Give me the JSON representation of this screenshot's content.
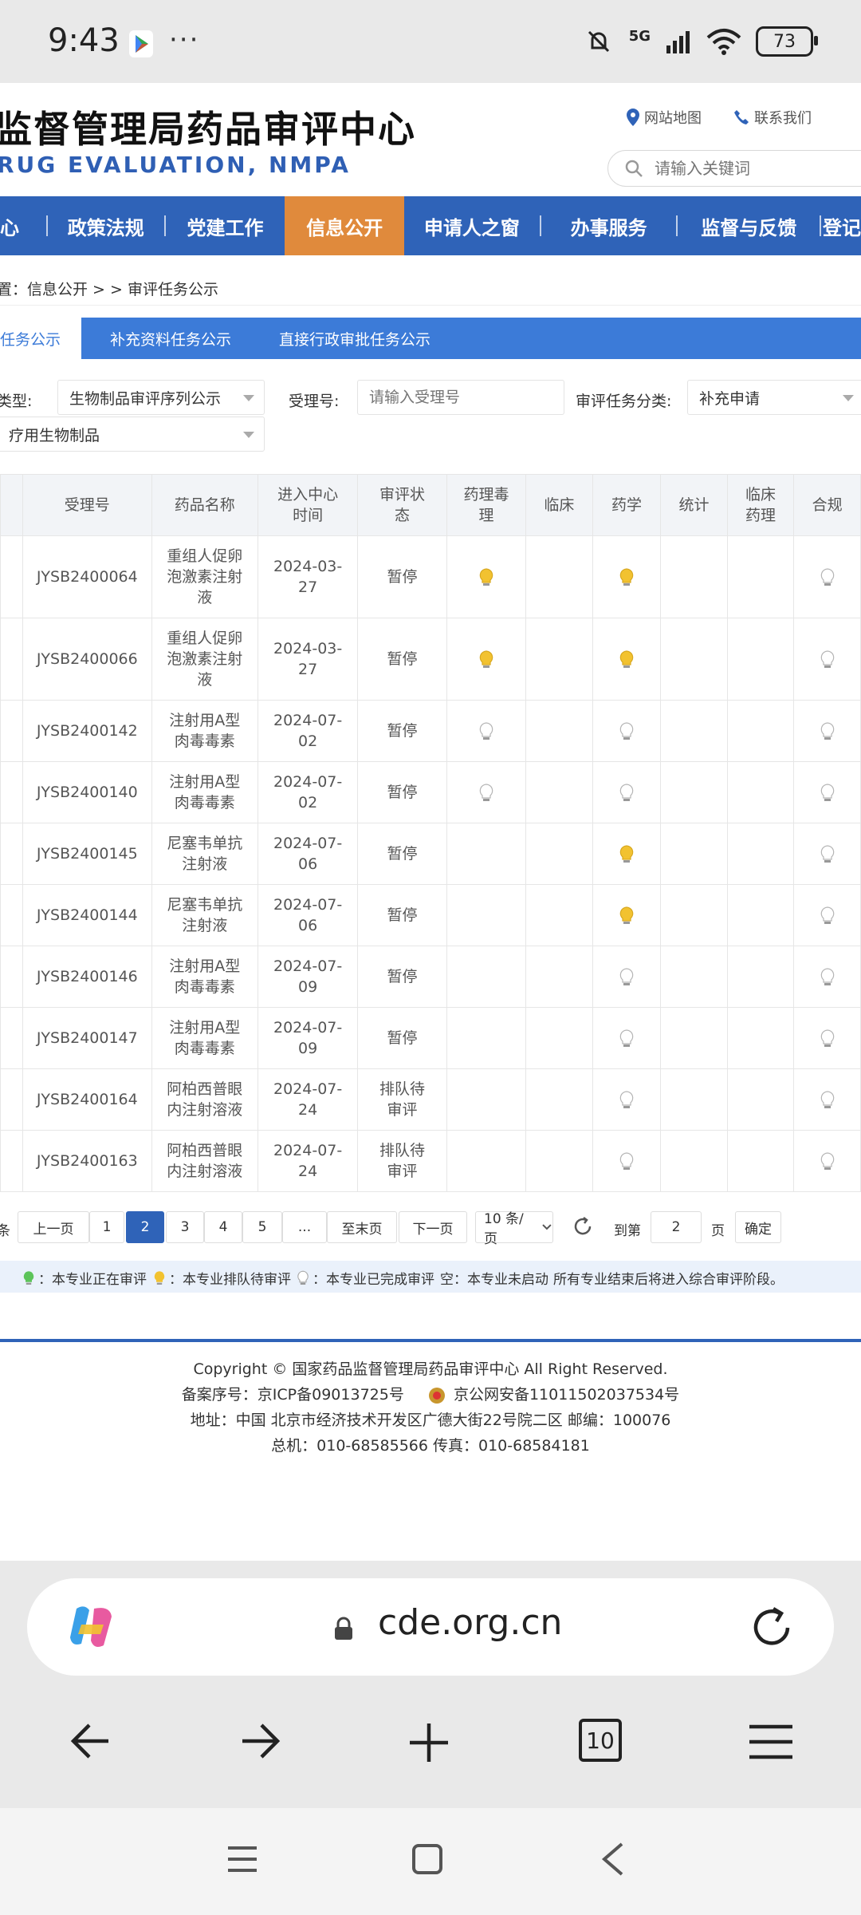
{
  "status_bar": {
    "time": "9:43",
    "dots": "···",
    "network": "5G",
    "battery": "73"
  },
  "header": {
    "title": "监督管理局药品审评中心",
    "subtitle": "RUG EVALUATION, NMPA",
    "links": [
      "网站地图",
      "联系我们"
    ],
    "search_placeholder": "请输入关键词"
  },
  "nav": {
    "items": [
      "心",
      "政策法规",
      "党建工作",
      "信息公开",
      "申请人之窗",
      "办事服务",
      "监督与反馈",
      "登记"
    ],
    "active_index": 3
  },
  "breadcrumb": "置：信息公开 > > 审评任务公示",
  "tabs": [
    "任务公示",
    "补充资料任务公示",
    "直接行政审批任务公示"
  ],
  "filters": {
    "type_label": "类型:",
    "type_value": "生物制品审评序列公示",
    "accept_label": "受理号:",
    "accept_placeholder": "请输入受理号",
    "category_label": "审评任务分类:",
    "category_value": "补充申请",
    "second_value": "疗用生物制品"
  },
  "table": {
    "headers": [
      "受理号",
      "药品名称",
      "进入中心时间",
      "审评状态",
      "药理毒理",
      "临床",
      "药学",
      "统计",
      "临床药理",
      "合规"
    ],
    "header_lines": [
      [
        "受理号"
      ],
      [
        "药品名称"
      ],
      [
        "进入中心",
        "时间"
      ],
      [
        "审评状",
        "态"
      ],
      [
        "药理毒",
        "理"
      ],
      [
        "临床"
      ],
      [
        "药学"
      ],
      [
        "统计"
      ],
      [
        "临床",
        "药理"
      ],
      [
        "合规"
      ]
    ],
    "rows": [
      {
        "id": "JYSB2400064",
        "name": [
          "重组人促卵",
          "泡激素注射",
          "液"
        ],
        "date": [
          "2024-03-",
          "27"
        ],
        "status": [
          "暂停"
        ],
        "tox": "yellow",
        "clin": "",
        "pharm": "yellow",
        "stat": "",
        "cpharm": "",
        "comp": "white"
      },
      {
        "id": "JYSB2400066",
        "name": [
          "重组人促卵",
          "泡激素注射",
          "液"
        ],
        "date": [
          "2024-03-",
          "27"
        ],
        "status": [
          "暂停"
        ],
        "tox": "yellow",
        "clin": "",
        "pharm": "yellow",
        "stat": "",
        "cpharm": "",
        "comp": "white"
      },
      {
        "id": "JYSB2400142",
        "name": [
          "注射用A型",
          "肉毒毒素"
        ],
        "date": [
          "2024-07-",
          "02"
        ],
        "status": [
          "暂停"
        ],
        "tox": "white",
        "clin": "",
        "pharm": "white",
        "stat": "",
        "cpharm": "",
        "comp": "white"
      },
      {
        "id": "JYSB2400140",
        "name": [
          "注射用A型",
          "肉毒毒素"
        ],
        "date": [
          "2024-07-",
          "02"
        ],
        "status": [
          "暂停"
        ],
        "tox": "white",
        "clin": "",
        "pharm": "white",
        "stat": "",
        "cpharm": "",
        "comp": "white"
      },
      {
        "id": "JYSB2400145",
        "name": [
          "尼塞韦单抗",
          "注射液"
        ],
        "date": [
          "2024-07-",
          "06"
        ],
        "status": [
          "暂停"
        ],
        "tox": "",
        "clin": "",
        "pharm": "yellow",
        "stat": "",
        "cpharm": "",
        "comp": "white"
      },
      {
        "id": "JYSB2400144",
        "name": [
          "尼塞韦单抗",
          "注射液"
        ],
        "date": [
          "2024-07-",
          "06"
        ],
        "status": [
          "暂停"
        ],
        "tox": "",
        "clin": "",
        "pharm": "yellow",
        "stat": "",
        "cpharm": "",
        "comp": "white"
      },
      {
        "id": "JYSB2400146",
        "name": [
          "注射用A型",
          "肉毒毒素"
        ],
        "date": [
          "2024-07-",
          "09"
        ],
        "status": [
          "暂停"
        ],
        "tox": "",
        "clin": "",
        "pharm": "white",
        "stat": "",
        "cpharm": "",
        "comp": "white"
      },
      {
        "id": "JYSB2400147",
        "name": [
          "注射用A型",
          "肉毒毒素"
        ],
        "date": [
          "2024-07-",
          "09"
        ],
        "status": [
          "暂停"
        ],
        "tox": "",
        "clin": "",
        "pharm": "white",
        "stat": "",
        "cpharm": "",
        "comp": "white"
      },
      {
        "id": "JYSB2400164",
        "name": [
          "阿柏西普眼",
          "内注射溶液"
        ],
        "date": [
          "2024-07-",
          "24"
        ],
        "status": [
          "排队待",
          "审评"
        ],
        "tox": "",
        "clin": "",
        "pharm": "white",
        "stat": "",
        "cpharm": "",
        "comp": "white"
      },
      {
        "id": "JYSB2400163",
        "name": [
          "阿柏西普眼",
          "内注射溶液"
        ],
        "date": [
          "2024-07-",
          "24"
        ],
        "status": [
          "排队待",
          "审评"
        ],
        "tox": "",
        "clin": "",
        "pharm": "white",
        "stat": "",
        "cpharm": "",
        "comp": "white"
      }
    ]
  },
  "pagination": {
    "left_text": "条",
    "prev": "上一页",
    "pages": [
      "1",
      "2",
      "3",
      "4",
      "5",
      "..."
    ],
    "current": "2",
    "last": "至末页",
    "next": "下一页",
    "per_page": "10 条/页",
    "goto_label": "到第",
    "goto_value": "2",
    "page_unit": "页",
    "confirm": "确定"
  },
  "legend": {
    "green": "：本专业正在审评",
    "yellow": "：本专业排队待审评",
    "white": "：本专业已完成审评",
    "empty": "空：本专业未启动",
    "note": "所有专业结束后将进入综合审评阶段。"
  },
  "footer": {
    "copyright": "Copyright © 国家药品监督管理局药品审评中心    All Right Reserved.",
    "icp": "备案序号：京ICP备09013725号",
    "police": "京公网安备11011502037534号",
    "address": "地址：中国 北京市经济技术开发区广德大街22号院二区     邮编：100076",
    "phone": "总机：010-68585566     传真：010-68584181"
  },
  "browser": {
    "url": "cde.org.cn",
    "tab_count": "10"
  },
  "colors": {
    "nav_blue": "#2f63b8",
    "active_orange": "#e08a3c",
    "tab_blue": "#3c7bd8",
    "bulb_yellow": "#f2c230",
    "bulb_green": "#5cc45a"
  }
}
